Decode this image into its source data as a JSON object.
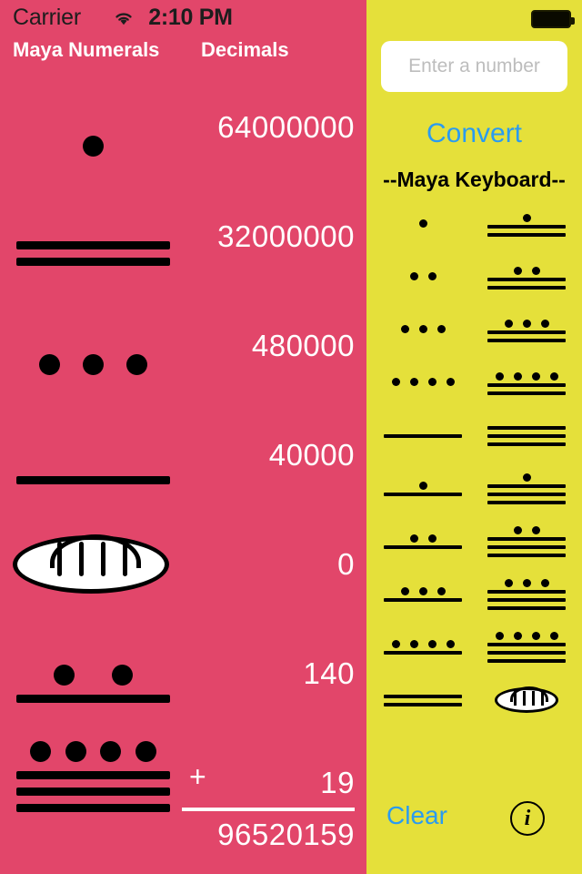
{
  "status_bar": {
    "carrier": "Carrier",
    "wifi_icon": "wifi-icon",
    "time": "2:10 PM",
    "battery_icon": "battery-full-icon"
  },
  "colors": {
    "left_panel_bg": "#E2466A",
    "right_panel_bg": "#E5E03A",
    "accent_blue": "#2A9BF0",
    "glyph_black": "#000000",
    "text_white": "#FFFFFF"
  },
  "left_panel": {
    "header_maya": "Maya Numerals",
    "header_decimals": "Decimals",
    "rows": [
      {
        "decimal": "64000000",
        "bars": 0,
        "dots": 1,
        "shell": false
      },
      {
        "decimal": "32000000",
        "bars": 2,
        "dots": 0,
        "shell": false
      },
      {
        "decimal": "480000",
        "bars": 0,
        "dots": 3,
        "shell": false
      },
      {
        "decimal": "40000",
        "bars": 1,
        "dots": 0,
        "shell": false
      },
      {
        "decimal": "0",
        "bars": 0,
        "dots": 0,
        "shell": true
      },
      {
        "decimal": "140",
        "bars": 1,
        "dots": 2,
        "shell": false
      },
      {
        "decimal": "19",
        "bars": 3,
        "dots": 4,
        "shell": false
      }
    ],
    "plus_sign": "+",
    "total": "96520159"
  },
  "right_panel": {
    "input_value": "",
    "input_placeholder": "Enter a number",
    "convert_label": "Convert",
    "keyboard_title": "--Maya Keyboard--",
    "keyboard_keys": [
      {
        "value": 1,
        "bars": 0,
        "dots": 1,
        "shell": false
      },
      {
        "value": 11,
        "bars": 2,
        "dots": 1,
        "shell": false
      },
      {
        "value": 2,
        "bars": 0,
        "dots": 2,
        "shell": false
      },
      {
        "value": 12,
        "bars": 2,
        "dots": 2,
        "shell": false
      },
      {
        "value": 3,
        "bars": 0,
        "dots": 3,
        "shell": false
      },
      {
        "value": 13,
        "bars": 2,
        "dots": 3,
        "shell": false
      },
      {
        "value": 4,
        "bars": 0,
        "dots": 4,
        "shell": false
      },
      {
        "value": 14,
        "bars": 2,
        "dots": 4,
        "shell": false
      },
      {
        "value": 5,
        "bars": 1,
        "dots": 0,
        "shell": false
      },
      {
        "value": 15,
        "bars": 3,
        "dots": 0,
        "shell": false
      },
      {
        "value": 6,
        "bars": 1,
        "dots": 1,
        "shell": false
      },
      {
        "value": 16,
        "bars": 3,
        "dots": 1,
        "shell": false
      },
      {
        "value": 7,
        "bars": 1,
        "dots": 2,
        "shell": false
      },
      {
        "value": 17,
        "bars": 3,
        "dots": 2,
        "shell": false
      },
      {
        "value": 8,
        "bars": 1,
        "dots": 3,
        "shell": false
      },
      {
        "value": 18,
        "bars": 3,
        "dots": 3,
        "shell": false
      },
      {
        "value": 9,
        "bars": 1,
        "dots": 4,
        "shell": false
      },
      {
        "value": 19,
        "bars": 3,
        "dots": 4,
        "shell": false
      },
      {
        "value": 10,
        "bars": 2,
        "dots": 0,
        "shell": false
      },
      {
        "value": 0,
        "bars": 0,
        "dots": 0,
        "shell": true
      }
    ],
    "clear_label": "Clear",
    "info_icon": "info-circle-icon",
    "info_glyph": "i"
  }
}
